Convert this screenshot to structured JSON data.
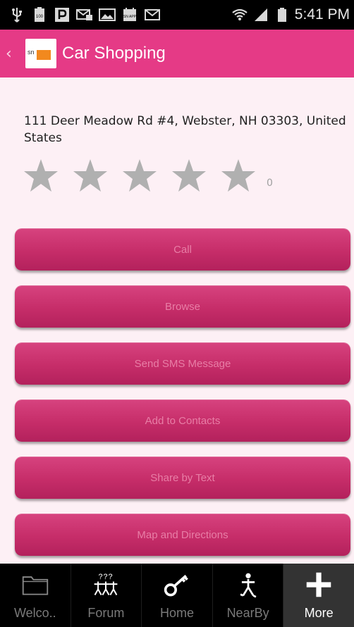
{
  "status_bar": {
    "time": "5:41 PM",
    "icons": [
      "usb-icon",
      "battery-100-icon",
      "parking-icon",
      "sms-icon",
      "gallery-icon",
      "app-icon",
      "gmail-icon",
      "wifi-icon",
      "signal-icon",
      "battery-icon"
    ],
    "battery_level_label": "100",
    "app_badge_label": "SN APP"
  },
  "action_bar": {
    "title": "Car Shopping",
    "logo_text": "sn"
  },
  "listing": {
    "address": "111 Deer Meadow Rd #4, Webster, NH 03303, United States",
    "rating": 0,
    "rating_count": "0"
  },
  "buttons": [
    {
      "label": "Call"
    },
    {
      "label": "Browse"
    },
    {
      "label": "Send SMS Message"
    },
    {
      "label": "Add to Contacts"
    },
    {
      "label": "Share by Text"
    },
    {
      "label": "Map and Directions"
    }
  ],
  "bottom_nav": [
    {
      "label": "Welco..",
      "icon": "folder-icon"
    },
    {
      "label": "Forum",
      "icon": "forum-icon"
    },
    {
      "label": "Home",
      "icon": "key-icon"
    },
    {
      "label": "NearBy",
      "icon": "walker-icon"
    },
    {
      "label": "More",
      "icon": "plus-icon",
      "active": true
    }
  ],
  "colors": {
    "accent": "#e53a86",
    "button": "#c62d69",
    "background": "#fdf0f5",
    "button_text": "#e87ea6"
  }
}
